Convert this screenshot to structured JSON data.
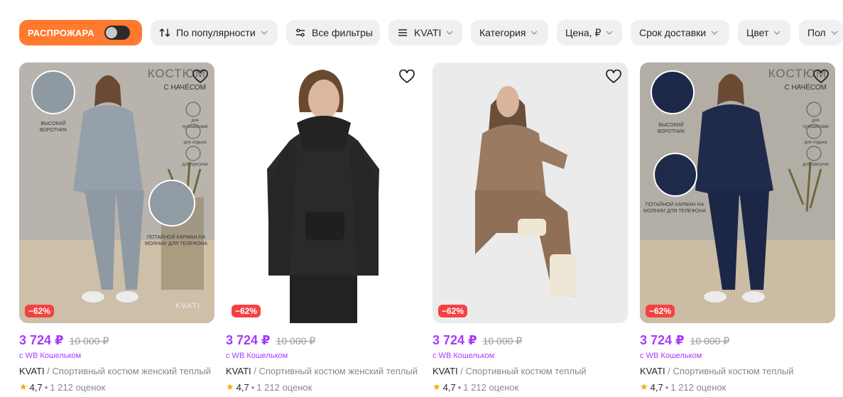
{
  "filters": {
    "sale_label": "РАСПРОЖАРА",
    "sort_label": "По популярности",
    "all_filters_label": "Все фильтры",
    "brand_label": "KVATI",
    "category_label": "Категория",
    "price_label": "Цена, ₽",
    "delivery_label": "Срок доставки",
    "color_label": "Цвет",
    "gender_label": "Пол"
  },
  "products": [
    {
      "discount": "−62%",
      "price": "3 724 ₽",
      "old_price": "10 000 ₽",
      "wallet": "с WB Кошельком",
      "brand": "KVATI",
      "separator": " / ",
      "name": "Спортивный костюм женский теплый",
      "rating": "4,7",
      "dot": "•",
      "reviews": "1 212 оценок",
      "overlay": {
        "title": "КОСТЮМ",
        "subtitle": "С НАЧЁСОМ",
        "collar": "ВЫСОКИЙ ВОРОТНИК",
        "pocket": "ПОТАЙНОЙ КАРМАН НА МОЛНИИ ДЛЯ ТЕЛЕФОНА",
        "travel": "для путешествий",
        "rest": "для отдыха",
        "walk": "для прогулок",
        "brand_mark": "KVATI"
      }
    },
    {
      "discount": "−62%",
      "price": "3 724 ₽",
      "old_price": "10 000 ₽",
      "wallet": "с WB Кошельком",
      "brand": "KVATI",
      "separator": " / ",
      "name": "Спортивный костюм женский теплый",
      "rating": "4,7",
      "dot": "•",
      "reviews": "1 212 оценок"
    },
    {
      "discount": "−62%",
      "price": "3 724 ₽",
      "old_price": "10 000 ₽",
      "wallet": "с WB Кошельком",
      "brand": "KVATI",
      "separator": " / ",
      "name": "Спортивный костюм теплый",
      "rating": "4,7",
      "dot": "•",
      "reviews": "1 212 оценок"
    },
    {
      "discount": "−62%",
      "price": "3 724 ₽",
      "old_price": "10 000 ₽",
      "wallet": "с WB Кошельком",
      "brand": "KVATI",
      "separator": " / ",
      "name": "Спортивный костюм теплый",
      "rating": "4,7",
      "dot": "•",
      "reviews": "1 212 оценок",
      "overlay": {
        "title": "КОСТЮМ",
        "subtitle": "С НАЧЁСОМ",
        "collar": "ВЫСОКИЙ ВОРОТНИК",
        "pocket": "ПОТАЙНОЙ КАРМАН НА МОЛНИИ ДЛЯ ТЕЛЕФОНА",
        "travel": "для путешествий",
        "rest": "для отдыха",
        "walk": "для прогулок"
      }
    }
  ],
  "colors": {
    "sale_orange": "#ff7a2f",
    "price_purple": "#a73afd",
    "discount_red": "#f44242",
    "star_yellow": "#ffa800",
    "chip_bg": "#f0f0f3"
  }
}
